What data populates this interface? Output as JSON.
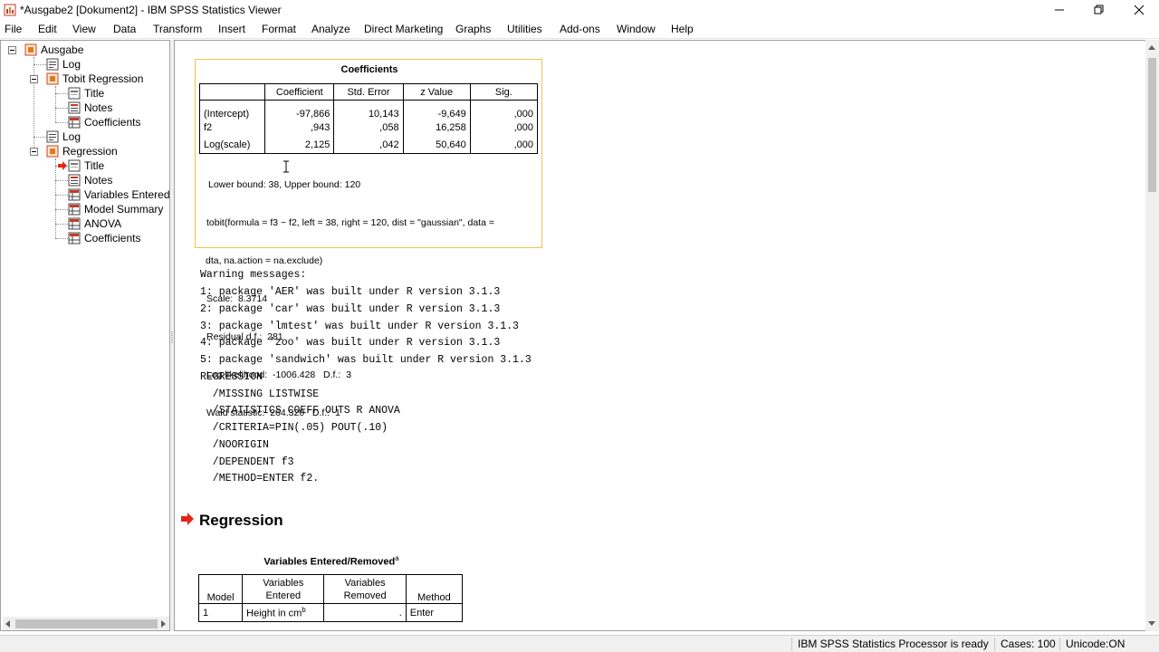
{
  "window": {
    "title": "*Ausgabe2 [Dokument2] - IBM SPSS Statistics Viewer"
  },
  "menu": [
    "File",
    "Edit",
    "View",
    "Data",
    "Transform",
    "Insert",
    "Format",
    "Analyze",
    "Direct Marketing",
    "Graphs",
    "Utilities",
    "Add-ons",
    "Window",
    "Help"
  ],
  "tree": {
    "root": "Ausgabe",
    "log1": "Log",
    "tobit": "Tobit Regression",
    "tobit_title": "Title",
    "tobit_notes": "Notes",
    "tobit_coefs": "Coefficients",
    "log2": "Log",
    "regression": "Regression",
    "reg_title": "Title",
    "reg_notes": "Notes",
    "reg_vars": "Variables Entered",
    "reg_summary": "Model Summary",
    "reg_anova": "ANOVA",
    "reg_coefs": "Coefficients"
  },
  "coefficients": {
    "title": "Coefficients",
    "headers": [
      "",
      "Coefficient",
      "Std. Error",
      "z Value",
      "Sig."
    ],
    "rows": [
      [
        "(Intercept)",
        "-97,866",
        "10,143",
        "-9,649",
        ",000"
      ],
      [
        "f2",
        ",943",
        ",058",
        "16,258",
        ",000"
      ],
      [
        "Log(scale)",
        "2,125",
        ",042",
        "50,640",
        ",000"
      ]
    ],
    "footnotes": [
      "Lower bound: 38, Upper bound: 120",
      "tobit(formula = f3 ~ f2, left = 38, right = 120, dist = \"gaussian\", data =",
      "dta, na.action = na.exclude)",
      "Scale:  8.3714",
      "Residual d.f.:  281",
      "Log likelihood:  -1006.428   D.f.:  3",
      "Wald statistic:  264.320   D.f.:  1"
    ]
  },
  "log_lines": [
    "Warning messages:",
    "1: package 'AER' was built under R version 3.1.3",
    "2: package 'car' was built under R version 3.1.3",
    "3: package 'lmtest' was built under R version 3.1.3",
    "4: package 'zoo' was built under R version 3.1.3",
    "5: package 'sandwich' was built under R version 3.1.3",
    "REGRESSION",
    "  /MISSING LISTWISE",
    "  /STATISTICS COEFF OUTS R ANOVA",
    "  /CRITERIA=PIN(.05) POUT(.10)",
    "  /NOORIGIN",
    "  /DEPENDENT f3",
    "  /METHOD=ENTER f2."
  ],
  "regression_heading": "Regression",
  "variables_table": {
    "title": "Variables Entered/Removed",
    "title_sup": "a",
    "headers": [
      "Model",
      "Variables Entered",
      "Variables Removed",
      "Method"
    ],
    "row": {
      "model": "1",
      "entered": "Height in cm",
      "entered_sup": "b",
      "removed": ".",
      "method": "Enter"
    }
  },
  "status": {
    "processor": "IBM SPSS Statistics Processor is ready",
    "cases": "Cases: 100",
    "unicode": "Unicode:ON"
  },
  "colors": {
    "accent_red": "#e3261b",
    "selection_border": "#f0c34a",
    "icon_orange": "#e07a1f"
  }
}
